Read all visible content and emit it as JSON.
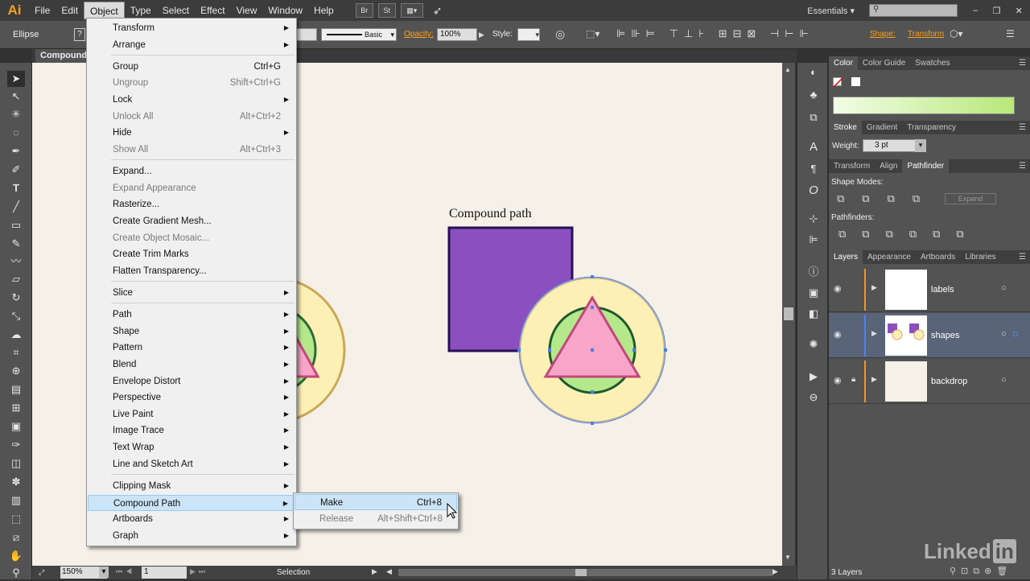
{
  "app": {
    "logo": "Ai"
  },
  "menubar": {
    "items": [
      "File",
      "Edit",
      "Object",
      "Type",
      "Select",
      "Effect",
      "View",
      "Window",
      "Help"
    ],
    "bridge": "Br",
    "stock": "St",
    "workspace": "Essentials",
    "search_placeholder": ""
  },
  "controlbar": {
    "selection_type": "Ellipse",
    "stroke_style": "Basic",
    "opacity_label": "Opacity:",
    "opacity_value": "100%",
    "style_label": "Style:",
    "shape_label": "Shape:",
    "transform_label": "Transform"
  },
  "document": {
    "tab_title": "Compound"
  },
  "canvas": {
    "label": "Compound path"
  },
  "object_menu": {
    "items": [
      {
        "label": "Transform",
        "shortcut": "",
        "submenu": true,
        "disabled": false
      },
      {
        "label": "Arrange",
        "shortcut": "",
        "submenu": true,
        "disabled": false
      },
      {
        "label": "Group",
        "shortcut": "Ctrl+G",
        "submenu": false,
        "disabled": false
      },
      {
        "label": "Ungroup",
        "shortcut": "Shift+Ctrl+G",
        "submenu": false,
        "disabled": true
      },
      {
        "label": "Lock",
        "shortcut": "",
        "submenu": true,
        "disabled": false
      },
      {
        "label": "Unlock All",
        "shortcut": "Alt+Ctrl+2",
        "submenu": false,
        "disabled": true
      },
      {
        "label": "Hide",
        "shortcut": "",
        "submenu": true,
        "disabled": false
      },
      {
        "label": "Show All",
        "shortcut": "Alt+Ctrl+3",
        "submenu": false,
        "disabled": true
      },
      {
        "label": "Expand...",
        "shortcut": "",
        "submenu": false,
        "disabled": false
      },
      {
        "label": "Expand Appearance",
        "shortcut": "",
        "submenu": false,
        "disabled": true
      },
      {
        "label": "Rasterize...",
        "shortcut": "",
        "submenu": false,
        "disabled": false
      },
      {
        "label": "Create Gradient Mesh...",
        "shortcut": "",
        "submenu": false,
        "disabled": false
      },
      {
        "label": "Create Object Mosaic...",
        "shortcut": "",
        "submenu": false,
        "disabled": true
      },
      {
        "label": "Create Trim Marks",
        "shortcut": "",
        "submenu": false,
        "disabled": false
      },
      {
        "label": "Flatten Transparency...",
        "shortcut": "",
        "submenu": false,
        "disabled": false
      },
      {
        "label": "Slice",
        "shortcut": "",
        "submenu": true,
        "disabled": false
      },
      {
        "label": "Path",
        "shortcut": "",
        "submenu": true,
        "disabled": false
      },
      {
        "label": "Shape",
        "shortcut": "",
        "submenu": true,
        "disabled": false
      },
      {
        "label": "Pattern",
        "shortcut": "",
        "submenu": true,
        "disabled": false
      },
      {
        "label": "Blend",
        "shortcut": "",
        "submenu": true,
        "disabled": false
      },
      {
        "label": "Envelope Distort",
        "shortcut": "",
        "submenu": true,
        "disabled": false
      },
      {
        "label": "Perspective",
        "shortcut": "",
        "submenu": true,
        "disabled": false
      },
      {
        "label": "Live Paint",
        "shortcut": "",
        "submenu": true,
        "disabled": false
      },
      {
        "label": "Image Trace",
        "shortcut": "",
        "submenu": true,
        "disabled": false
      },
      {
        "label": "Text Wrap",
        "shortcut": "",
        "submenu": true,
        "disabled": false
      },
      {
        "label": "Line and Sketch Art",
        "shortcut": "",
        "submenu": true,
        "disabled": false
      },
      {
        "label": "Clipping Mask",
        "shortcut": "",
        "submenu": true,
        "disabled": false
      },
      {
        "label": "Compound Path",
        "shortcut": "",
        "submenu": true,
        "disabled": false,
        "highlighted": true
      },
      {
        "label": "Artboards",
        "shortcut": "",
        "submenu": true,
        "disabled": false
      },
      {
        "label": "Graph",
        "shortcut": "",
        "submenu": true,
        "disabled": false
      }
    ]
  },
  "compound_submenu": {
    "items": [
      {
        "label": "Make",
        "shortcut": "Ctrl+8",
        "disabled": false
      },
      {
        "label": "Release",
        "shortcut": "Alt+Shift+Ctrl+8",
        "disabled": true
      }
    ]
  },
  "panels": {
    "color_tabs": [
      "Color",
      "Color Guide",
      "Swatches"
    ],
    "stroke_tabs": [
      "Stroke",
      "Gradient",
      "Transparency"
    ],
    "weight_label": "Weight:",
    "weight_value": "3 pt",
    "pathfinder_tabs": [
      "Transform",
      "Align",
      "Pathfinder"
    ],
    "shape_modes_label": "Shape Modes:",
    "expand_label": "Expand",
    "pathfinders_label": "Pathfinders:",
    "layers_tabs": [
      "Layers",
      "Appearance",
      "Artboards",
      "Libraries"
    ],
    "layers": [
      {
        "name": "labels",
        "color": "#f7941d",
        "locked": false,
        "selected": false
      },
      {
        "name": "shapes",
        "color": "#4f7ff5",
        "locked": false,
        "selected": true
      },
      {
        "name": "backdrop",
        "color": "#f7941d",
        "locked": true,
        "selected": false
      }
    ],
    "layer_count": "3 Layers"
  },
  "statusbar": {
    "zoom": "150%",
    "artboard": "1",
    "tool": "Selection"
  },
  "watermark": "Linked"
}
